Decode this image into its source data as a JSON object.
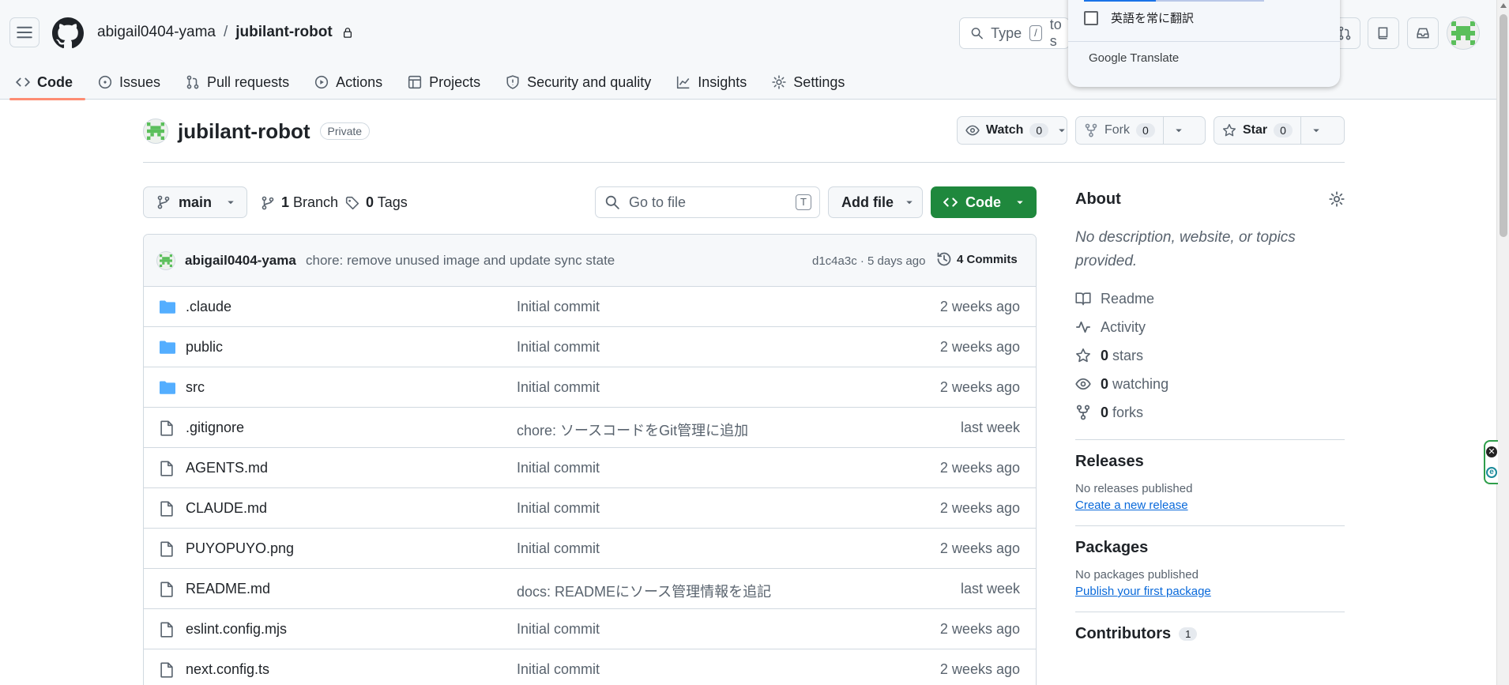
{
  "header": {
    "owner": "abigail0404-yama",
    "separator": "/",
    "repo": "jubilant-robot",
    "search_placeholder": "Type",
    "search_kbd": "/",
    "search_suffix": "to s"
  },
  "repo_nav": [
    {
      "label": "Code",
      "icon": "code-icon"
    },
    {
      "label": "Issues",
      "icon": "issue-icon"
    },
    {
      "label": "Pull requests",
      "icon": "pull-request-icon"
    },
    {
      "label": "Actions",
      "icon": "play-icon"
    },
    {
      "label": "Projects",
      "icon": "table-icon"
    },
    {
      "label": "Security and quality",
      "icon": "shield-icon"
    },
    {
      "label": "Insights",
      "icon": "graph-icon"
    },
    {
      "label": "Settings",
      "icon": "gear-icon"
    }
  ],
  "translate_popup": {
    "always_translate_label": "英語を常に翻訳",
    "brand": "Google Translate",
    "progress": 0.4
  },
  "repo_header": {
    "name": "jubilant-robot",
    "visibility": "Private",
    "watch_label": "Watch",
    "watch_count": "0",
    "fork_label": "Fork",
    "fork_count": "0",
    "star_label": "Star",
    "star_count": "0"
  },
  "toolbar": {
    "branch": "main",
    "branch_count": "1",
    "branch_label": "Branch",
    "tag_count": "0",
    "tag_label": "Tags",
    "goto_placeholder": "Go to file",
    "goto_kbd": "T",
    "add_file_label": "Add file",
    "code_label": "Code"
  },
  "latest_commit": {
    "author": "abigail0404-yama",
    "message": "chore: remove unused image and update sync state",
    "meta": "d1c4a3c · 5 days ago",
    "count_label": "4 Commits"
  },
  "files": [
    {
      "name": ".claude",
      "type": "folder",
      "message": "Initial commit",
      "age": "2 weeks ago"
    },
    {
      "name": "public",
      "type": "folder",
      "message": "Initial commit",
      "age": "2 weeks ago"
    },
    {
      "name": "src",
      "type": "folder",
      "message": "Initial commit",
      "age": "2 weeks ago"
    },
    {
      "name": ".gitignore",
      "type": "file",
      "message": "chore: ソースコードをGit管理に追加",
      "age": "last week"
    },
    {
      "name": "AGENTS.md",
      "type": "file",
      "message": "Initial commit",
      "age": "2 weeks ago"
    },
    {
      "name": "CLAUDE.md",
      "type": "file",
      "message": "Initial commit",
      "age": "2 weeks ago"
    },
    {
      "name": "PUYOPUYO.png",
      "type": "file",
      "message": "Initial commit",
      "age": "2 weeks ago"
    },
    {
      "name": "README.md",
      "type": "file",
      "message": "docs: READMEにソース管理情報を追記",
      "age": "last week"
    },
    {
      "name": "eslint.config.mjs",
      "type": "file",
      "message": "Initial commit",
      "age": "2 weeks ago"
    },
    {
      "name": "next.config.ts",
      "type": "file",
      "message": "Initial commit",
      "age": "2 weeks ago"
    }
  ],
  "sidebar": {
    "about_title": "About",
    "about_desc": "No description, website, or topics provided.",
    "readme": "Readme",
    "activity": "Activity",
    "stars_count": "0",
    "stars_label": "stars",
    "watching_count": "0",
    "watching_label": "watching",
    "forks_count": "0",
    "forks_label": "forks",
    "releases_title": "Releases",
    "releases_empty": "No releases published",
    "releases_link": "Create a new release",
    "packages_title": "Packages",
    "packages_empty": "No packages published",
    "packages_link": "Publish your first package",
    "contributors_title": "Contributors",
    "contributors_count": "1"
  },
  "colors": {
    "accent_green": "#1f883d",
    "link_blue": "#0969da",
    "active_tab_underline": "#fd8c73",
    "folder_blue": "#54aeff"
  }
}
